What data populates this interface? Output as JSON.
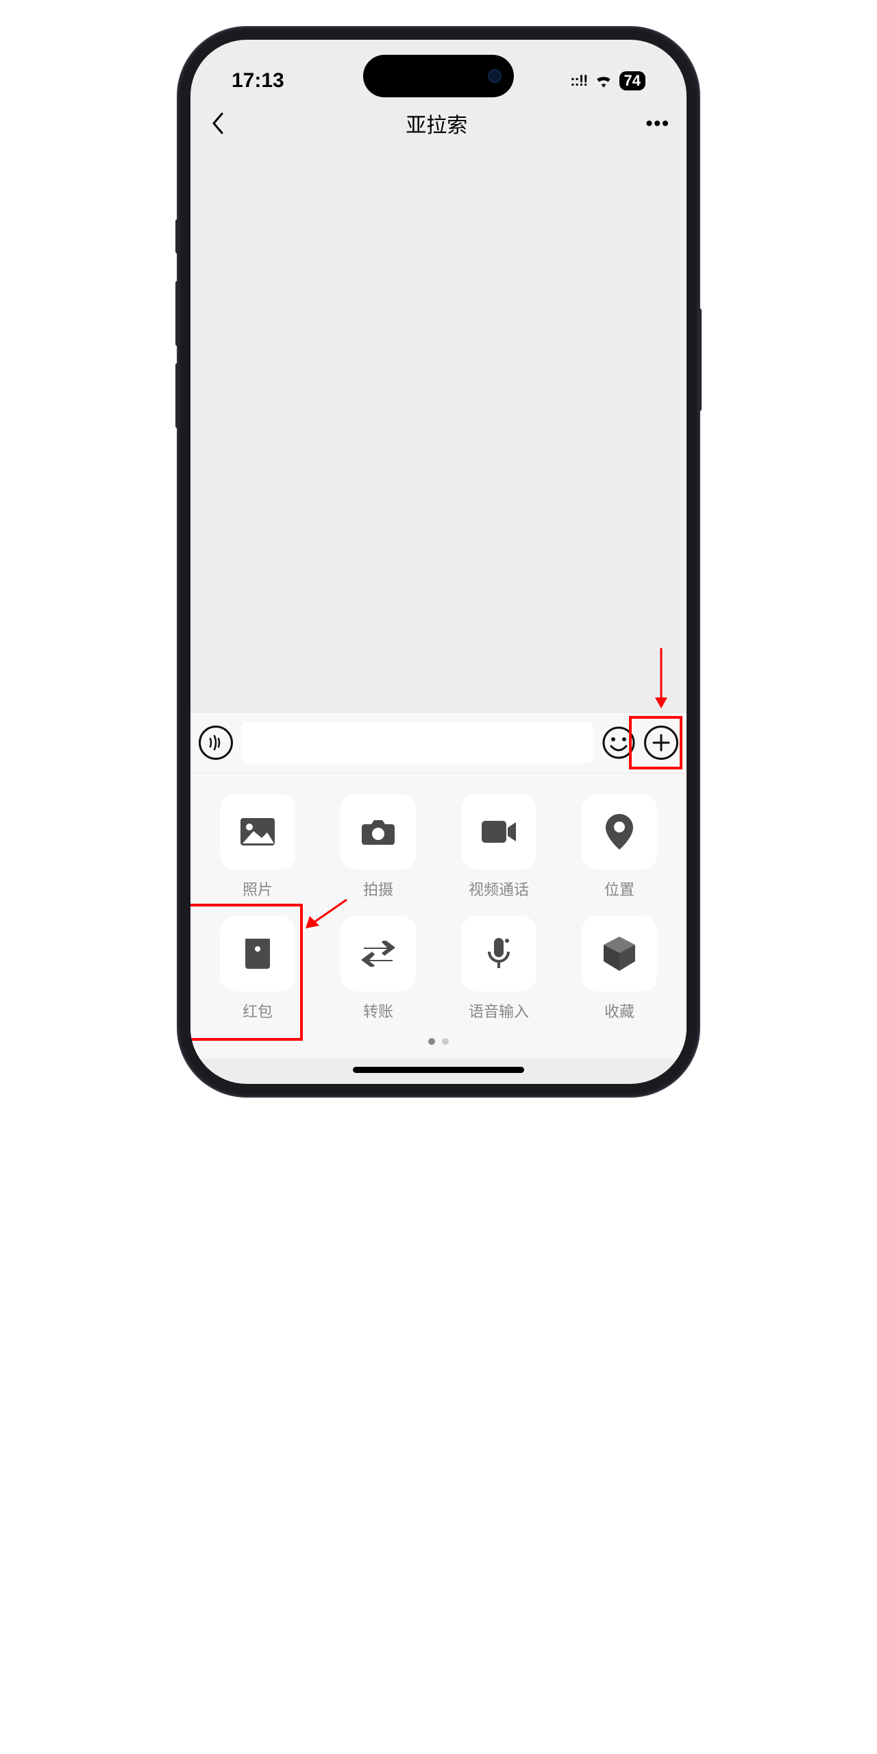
{
  "status": {
    "time": "17:13",
    "battery": "74"
  },
  "nav": {
    "title": "亚拉索"
  },
  "attachments": {
    "row1": [
      {
        "label": "照片",
        "icon": "image-icon"
      },
      {
        "label": "拍摄",
        "icon": "camera-icon"
      },
      {
        "label": "视频通话",
        "icon": "video-icon"
      },
      {
        "label": "位置",
        "icon": "location-icon"
      }
    ],
    "row2": [
      {
        "label": "红包",
        "icon": "redpacket-icon"
      },
      {
        "label": "转账",
        "icon": "transfer-icon"
      },
      {
        "label": "语音输入",
        "icon": "mic-icon"
      },
      {
        "label": "收藏",
        "icon": "favorite-icon"
      }
    ]
  },
  "annotations": {
    "highlight_plus": true,
    "highlight_redpacket": true
  }
}
